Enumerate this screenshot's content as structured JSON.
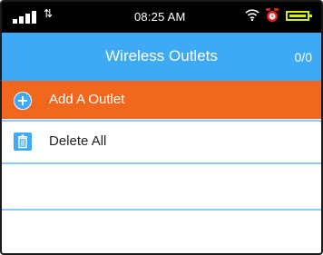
{
  "status_bar": {
    "time": "08:25 AM",
    "signal_icon": "signal-bars-icon",
    "data_icon": "data-transfer-icon",
    "wifi_icon": "wifi-icon",
    "alarm_icon": "alarm-clock-icon",
    "battery_icon": "battery-icon",
    "battery_color": "#d8f000"
  },
  "header": {
    "title": "Wireless Outlets",
    "count": "0/0",
    "background": "#3ea9f4"
  },
  "menu": {
    "add_label": "Add A Outlet",
    "add_icon": "plus-circle-icon",
    "add_background": "#f2671e",
    "delete_label": "Delete All",
    "delete_icon": "trash-icon"
  }
}
